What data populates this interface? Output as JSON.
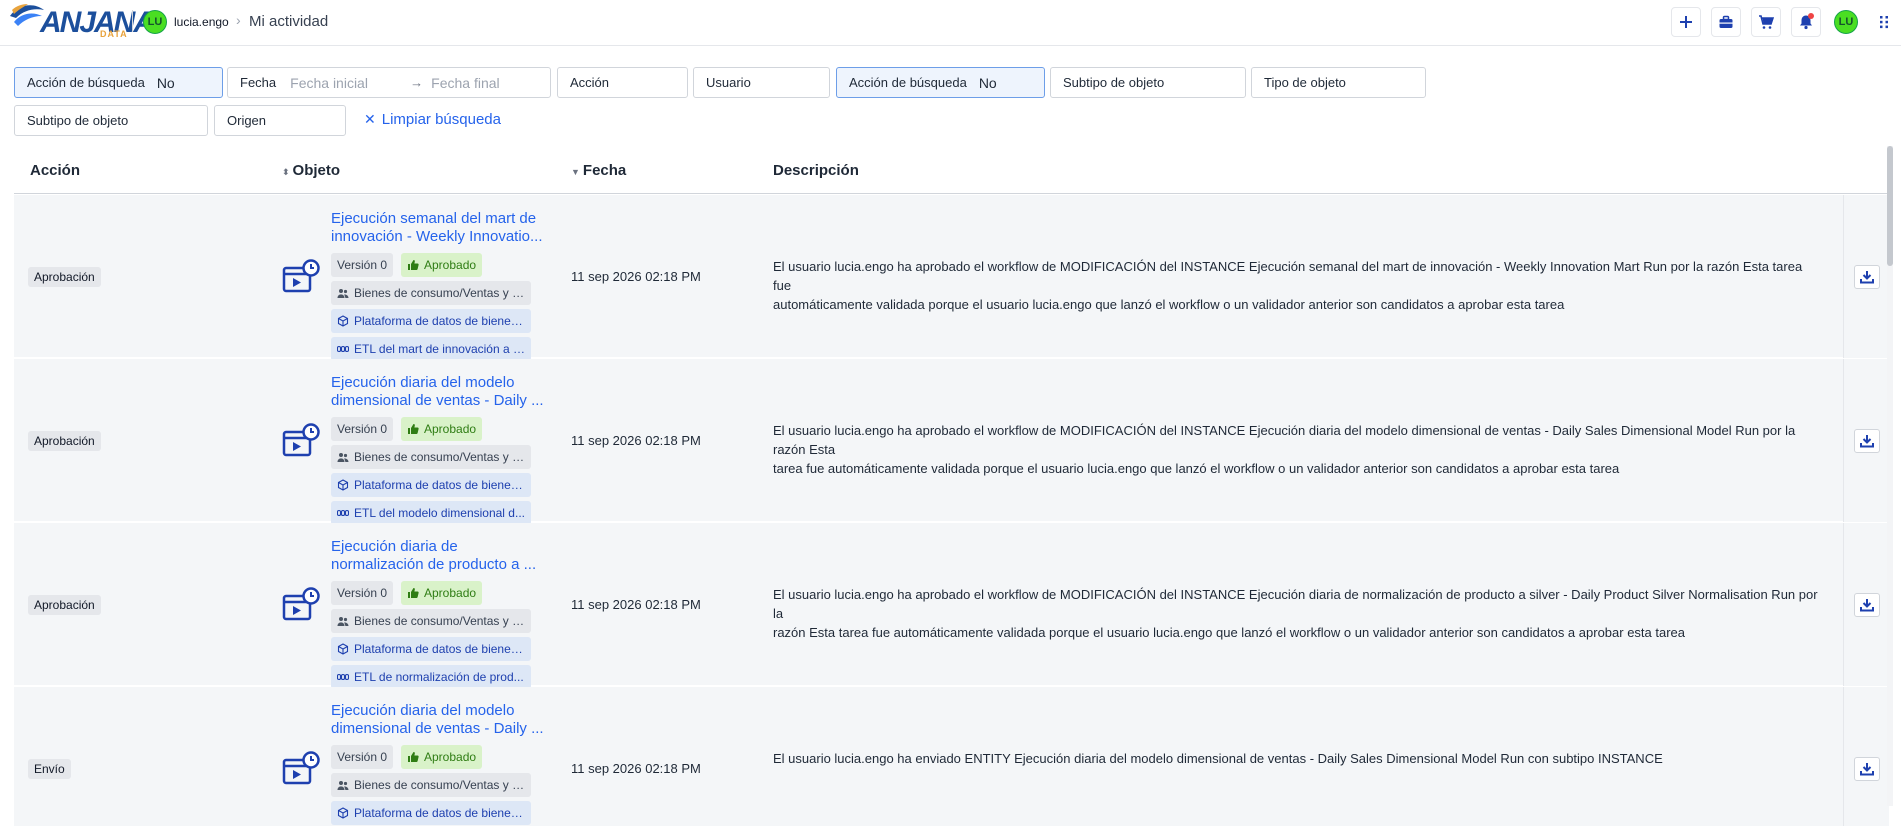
{
  "header": {
    "logo_text": "ANJANA",
    "logo_sub": "DATA",
    "user_initials": "LU",
    "username": "lucia.engo",
    "breadcrumb": "Mi actividad",
    "avatar_initials": "LU"
  },
  "filters": {
    "accion_busqueda_1": {
      "label": "Acción de búsqueda",
      "value": "No"
    },
    "fecha": {
      "label": "Fecha",
      "start_placeholder": "Fecha inicial",
      "end_placeholder": "Fecha final"
    },
    "accion": {
      "label": "Acción"
    },
    "usuario": {
      "label": "Usuario"
    },
    "accion_busqueda_2": {
      "label": "Acción de búsqueda",
      "value": "No"
    },
    "subtipo_objeto_1": {
      "label": "Subtipo de objeto"
    },
    "tipo_objeto": {
      "label": "Tipo de objeto"
    },
    "subtipo_objeto_2": {
      "label": "Subtipo de objeto"
    },
    "origen": {
      "label": "Origen"
    },
    "clear": "Limpiar búsqueda"
  },
  "table": {
    "headers": {
      "accion": "Acción",
      "objeto": "Objeto",
      "fecha": "Fecha",
      "descripcion": "Descripción"
    },
    "rows": [
      {
        "action": "Aprobación",
        "title_line1": "Ejecución semanal del mart de",
        "title_line2": "innovación - Weekly Innovatio...",
        "version": "Versión 0",
        "status": "Aprobado",
        "domain": "Bienes de consumo/Ventas y c...",
        "platform": "Plataforma de datos de bienes...",
        "etl": "ETL del mart de innovación a g...",
        "date": "11 sep 2026 02:18 PM",
        "desc_line1": "El usuario lucia.engo ha aprobado el workflow de MODIFICACIÓN del INSTANCE Ejecución semanal del mart de innovación - Weekly Innovation Mart Run por la razón Esta tarea fue",
        "desc_line2": "automáticamente validada porque el usuario lucia.engo que lanzó el workflow o un validador anterior son candidatos a aprobar esta tarea"
      },
      {
        "action": "Aprobación",
        "title_line1": "Ejecución diaria del modelo",
        "title_line2": "dimensional de ventas - Daily ...",
        "version": "Versión 0",
        "status": "Aprobado",
        "domain": "Bienes de consumo/Ventas y c...",
        "platform": "Plataforma de datos de bienes...",
        "etl": "ETL del modelo dimensional d...",
        "date": "11 sep 2026 02:18 PM",
        "desc_line1": "El usuario lucia.engo ha aprobado el workflow de MODIFICACIÓN del INSTANCE Ejecución diaria del modelo dimensional de ventas - Daily Sales Dimensional Model Run por la razón Esta",
        "desc_line2": "tarea fue automáticamente validada porque el usuario lucia.engo que lanzó el workflow o un validador anterior son candidatos a aprobar esta tarea"
      },
      {
        "action": "Aprobación",
        "title_line1": "Ejecución diaria de",
        "title_line2": "normalización de producto a ...",
        "version": "Versión 0",
        "status": "Aprobado",
        "domain": "Bienes de consumo/Ventas y c...",
        "platform": "Plataforma de datos de bienes...",
        "etl": "ETL de normalización de prod...",
        "date": "11 sep 2026 02:18 PM",
        "desc_line1": "El usuario lucia.engo ha aprobado el workflow de MODIFICACIÓN del INSTANCE Ejecución diaria de normalización de producto a silver - Daily Product Silver Normalisation Run por la",
        "desc_line2": "razón Esta tarea fue automáticamente validada porque el usuario lucia.engo que lanzó el workflow o un validador anterior son candidatos a aprobar esta tarea"
      },
      {
        "action": "Envío",
        "title_line1": "Ejecución diaria del modelo",
        "title_line2": "dimensional de ventas - Daily ...",
        "version": "Versión 0",
        "status": "Aprobado",
        "domain": "Bienes de consumo/Ventas y c...",
        "platform": "Plataforma de datos de bienes...",
        "etl": "",
        "date": "11 sep 2026 02:18 PM",
        "desc_line1": "El usuario lucia.engo ha enviado ENTITY Ejecución diaria del modelo dimensional de ventas - Daily Sales Dimensional Model Run con subtipo INSTANCE",
        "desc_line2": ""
      }
    ]
  },
  "colors": {
    "accent": "#2563eb",
    "approved_bg": "#d9f2c9",
    "approved_fg": "#2f7d14",
    "avatar": "#4ade22",
    "notif": "#ef4444"
  },
  "icons": [
    "plus-icon",
    "briefcase-icon",
    "cart-icon",
    "bell-icon",
    "grid-icon",
    "download-icon",
    "instance-icon",
    "thumbs-up-icon",
    "users-icon",
    "cube-icon",
    "etl-icon",
    "close-icon"
  ]
}
